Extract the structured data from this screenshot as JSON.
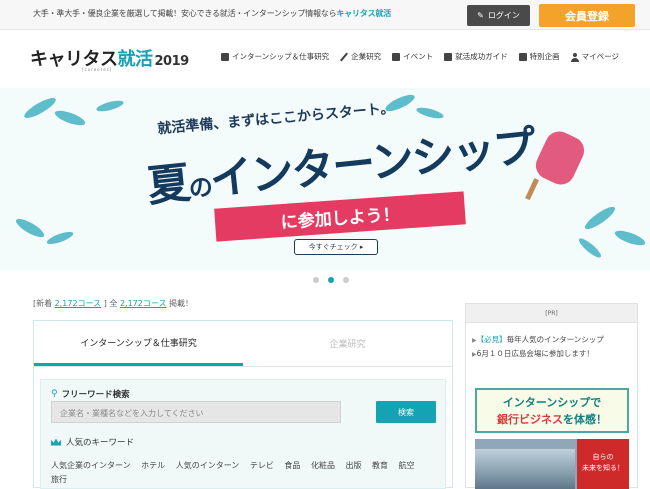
{
  "topbar": {
    "message": "大手・準大手・優良企業を厳選して掲載！安心できる就活・インターンシップ情報なら",
    "message_highlight": "キャリタス就活",
    "login_label": "ログイン",
    "register_label": "会員登録"
  },
  "header": {
    "logo_main": "キャリタス",
    "logo_accent": "就活",
    "logo_year": "2019",
    "logo_sub": "[careeres]",
    "nav": [
      {
        "label": "インターンシップ＆仕事研究",
        "icon": "building-icon"
      },
      {
        "label": "企業研究",
        "icon": "pen-icon"
      },
      {
        "label": "イベント",
        "icon": "calendar-icon"
      },
      {
        "label": "就活成功ガイド",
        "icon": "book-icon"
      },
      {
        "label": "特別企画",
        "icon": "star-box-icon"
      },
      {
        "label": "マイページ",
        "icon": "user-icon"
      }
    ]
  },
  "hero": {
    "line1": "就活準備、まずはここからスタート。",
    "title_a": "夏",
    "title_b": "の",
    "title_c": "インターンシップ",
    "ribbon": "に参加しよう！",
    "cta": "今すぐチェック ▸",
    "slides": 3,
    "active_slide": 2
  },
  "counts": {
    "new_label": "[新着",
    "new_value": "2,172コース",
    "sep": "]",
    "all_label": "全",
    "all_value": "2,172コース",
    "suffix": "掲載！"
  },
  "search": {
    "tabs": [
      {
        "label": "インターンシップ＆仕事研究",
        "active": true
      },
      {
        "label": "企業研究",
        "active": false
      }
    ],
    "freeword_title": "フリーワード検索",
    "placeholder": "企業名・業種名などを入力してください",
    "button": "検索",
    "popular_title": "人気のキーワード",
    "keywords": [
      "人気企業のインターン",
      "ホテル",
      "人気のインターン",
      "テレビ",
      "食品",
      "化粧品",
      "出版",
      "教育",
      "航空",
      "旅行"
    ]
  },
  "pr": {
    "label": "[PR]",
    "ad_prefix": "【必見】",
    "ad_text1": "毎年人気のインターンシップ",
    "ad_text2": "6月１０日広島会場に参加します！",
    "banner_line1": "インターンシップで",
    "banner_line2a": "銀行ビジネス",
    "banner_line2b": "を体感！",
    "img_line1": "自らの",
    "img_line2": "未来を知る！"
  },
  "colors": {
    "accent": "#15a3b3",
    "register": "#f3a32a",
    "ribbon": "#e43b63",
    "navy": "#143a5e"
  }
}
